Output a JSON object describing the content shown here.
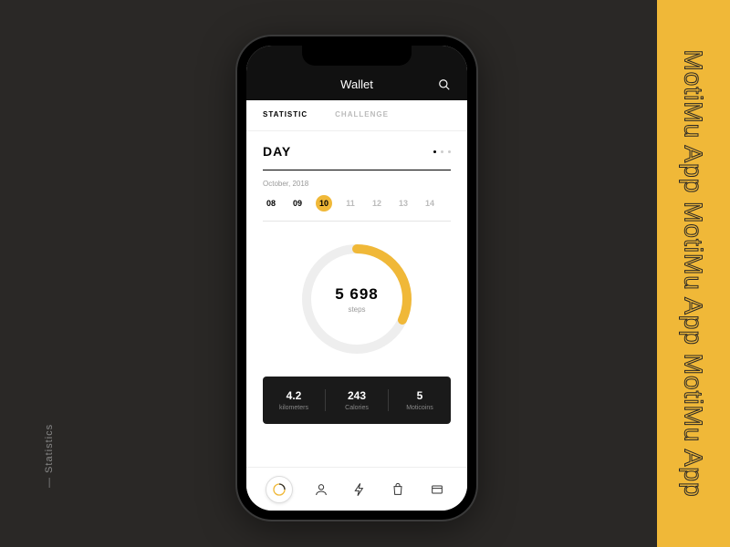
{
  "brand": {
    "band_text": "MotiMu App  MotiMu App  MotiMu App"
  },
  "side_label": "— Statistics",
  "header": {
    "title": "Wallet"
  },
  "tabs": [
    {
      "label": "STATISTIC",
      "active": true
    },
    {
      "label": "CHALLENGE",
      "active": false
    }
  ],
  "period": {
    "label": "DAY",
    "active_dot": 0
  },
  "calendar": {
    "month": "October, 2018",
    "days": [
      "08",
      "09",
      "10",
      "11",
      "12",
      "13",
      "14"
    ],
    "selected": "10",
    "past": [
      "08",
      "09"
    ]
  },
  "chart_data": {
    "type": "pie",
    "title": "",
    "values": [
      5698
    ],
    "max": 18000,
    "progress_pct": 32,
    "center_value": "5 698",
    "center_label": "steps"
  },
  "stats": [
    {
      "value": "4.2",
      "label": "kilometers"
    },
    {
      "value": "243",
      "label": "Calories"
    },
    {
      "value": "5",
      "label": "Moticoins"
    }
  ],
  "nav": {
    "items": [
      "stats",
      "profile",
      "energy",
      "shop",
      "wallet"
    ],
    "active": "stats"
  },
  "colors": {
    "accent": "#f0b838",
    "dark": "#1a1a1a",
    "bg": "#2a2826"
  }
}
